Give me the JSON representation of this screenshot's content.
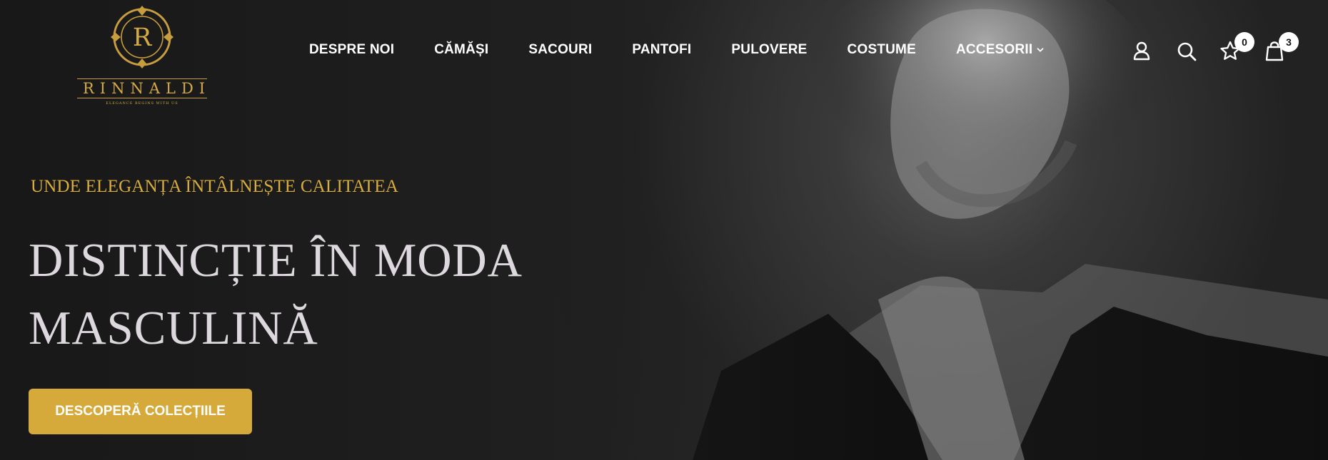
{
  "brand": {
    "name": "RINNALDI",
    "monogram": "R",
    "tagline": "ELEGANCE BEGINS WITH US",
    "gold": "#d4aa45"
  },
  "nav": {
    "items": [
      {
        "label": "DESPRE NOI"
      },
      {
        "label": "CĂMĂȘI"
      },
      {
        "label": "SACOURI"
      },
      {
        "label": "PANTOFI"
      },
      {
        "label": "PULOVERE"
      },
      {
        "label": "COSTUME"
      },
      {
        "label": "ACCESORII",
        "icon": "chevron-down-icon"
      }
    ]
  },
  "header_icons": {
    "account": "user-icon",
    "search": "search-icon",
    "wishlist": "star-icon",
    "cart": "shopping-bag-icon",
    "wishlist_count": "0",
    "cart_count": "3"
  },
  "hero": {
    "kicker": "UNDE ELEGANȚA ÎNTÂLNEȘTE CALITATEA",
    "headline_line1": "DISTINCȚIE ÎN MODA",
    "headline_line2": "MASCULINĂ",
    "cta_label": "DESCOPERĂ COLECȚIILE",
    "kicker_color": "#d9ad3d",
    "headline_color": "#ddd7de",
    "cta_color": "#d6a93b"
  },
  "colors": {
    "background": "#1b1b1b",
    "nav_text": "#ffffff"
  }
}
